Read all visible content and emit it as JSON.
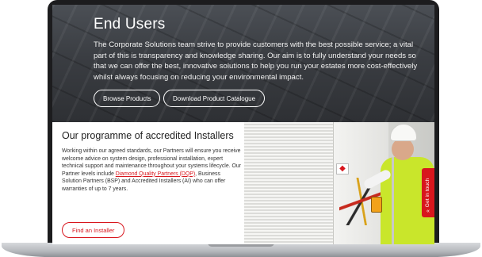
{
  "hero": {
    "title": "End Users",
    "text": "The Corporate Solutions team strive to provide customers with the best possible service; a vital part of this is transparency and knowledge sharing. Our aim is to fully understand your needs so that we can offer the best, innovative solutions to help you run your estates more cost-effectively whilst always focusing on reducing your environmental impact.",
    "browse_label": "Browse Products",
    "download_label": "Download Product Catalogue"
  },
  "programme": {
    "title": "Our programme of accredited Installers",
    "text_before": "Working within our agreed standards, our Partners will ensure you receive welcome advice on system design, professional installation, expert technical support and maintenance throughout your systems lifecycle. Our Partner levels include ",
    "link_text": "Diamond Quality Partners (DQP)",
    "text_after": ", Business Solution Partners (BSP) and Accredited Installers (AI) who can offer warranties of up to 7 years.",
    "find_label": "Find an Installer"
  },
  "side_tab": {
    "label": "Get in touch",
    "icon": "chevron-double-left-icon"
  },
  "colors": {
    "accent": "#d8161d",
    "hero_text": "#ffffff",
    "vest": "#c9e62b"
  }
}
